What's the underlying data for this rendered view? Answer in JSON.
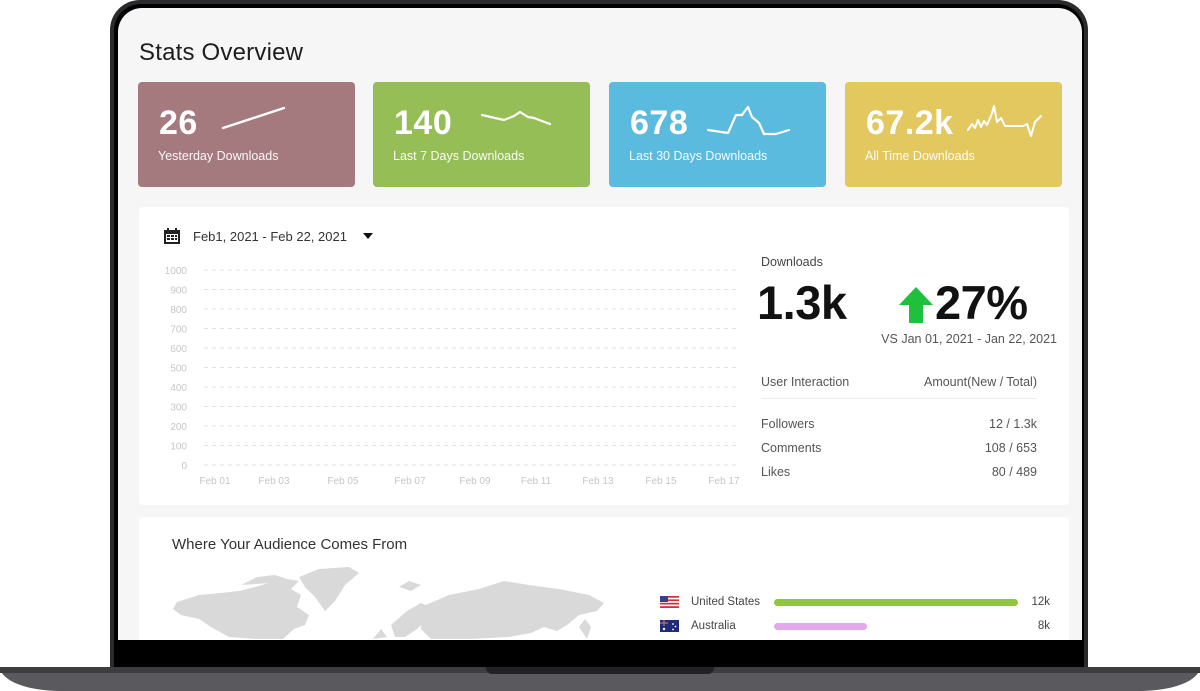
{
  "page": {
    "title": "Stats Overview"
  },
  "cards": [
    {
      "value": "26",
      "label": "Yesterday Downloads",
      "color": "#a47a7e",
      "icon": "sparkline-icon"
    },
    {
      "value": "140",
      "label": "Last 7 Days Downloads",
      "color": "#96be56",
      "icon": "sparkline-icon"
    },
    {
      "value": "678",
      "label": "Last 30 Days Downloads",
      "color": "#5abbde",
      "icon": "sparkline-icon"
    },
    {
      "value": "67.2k",
      "label": "All Time Downloads",
      "color": "#e2c85e",
      "icon": "sparkline-icon"
    }
  ],
  "date_range": {
    "label": "Feb1, 2021 - Feb 22, 2021",
    "icon": "calendar-icon"
  },
  "chart_data": {
    "type": "line",
    "title": "",
    "xlabel": "",
    "ylabel": "",
    "ylim": [
      0,
      1000
    ],
    "yticks": [
      "1000",
      "900",
      "800",
      "700",
      "600",
      "500",
      "400",
      "300",
      "200",
      "100",
      "0"
    ],
    "categories": [
      "Feb 01",
      "Feb 03",
      "Feb 05",
      "Feb 07",
      "Feb 09",
      "Feb 11",
      "Feb 13",
      "Feb 15",
      "Feb 17"
    ],
    "series": [],
    "grid": true
  },
  "downloads": {
    "label": "Downloads",
    "total": "1.3k",
    "change": "27%",
    "change_direction": "up",
    "change_color": "#1ec03c",
    "comparison": "VS Jan 01, 2021 - Jan 22, 2021"
  },
  "interactions": {
    "header": [
      "User Interaction",
      "Amount(New / Total)"
    ],
    "rows": [
      {
        "name": "Followers",
        "amount": "12 / 1.3k"
      },
      {
        "name": "Comments",
        "amount": "108 / 653"
      },
      {
        "name": "Likes",
        "amount": "80 / 489"
      }
    ]
  },
  "audience": {
    "title": "Where Your Audience Comes From",
    "countries": [
      {
        "name": "United States",
        "value": "12k",
        "share": 1.0,
        "color": "#8fc63a",
        "flag": "us-flag-icon"
      },
      {
        "name": "Australia",
        "value": "8k",
        "share": 0.38,
        "color": "#e3a8ee",
        "flag": "au-flag-icon"
      }
    ]
  }
}
